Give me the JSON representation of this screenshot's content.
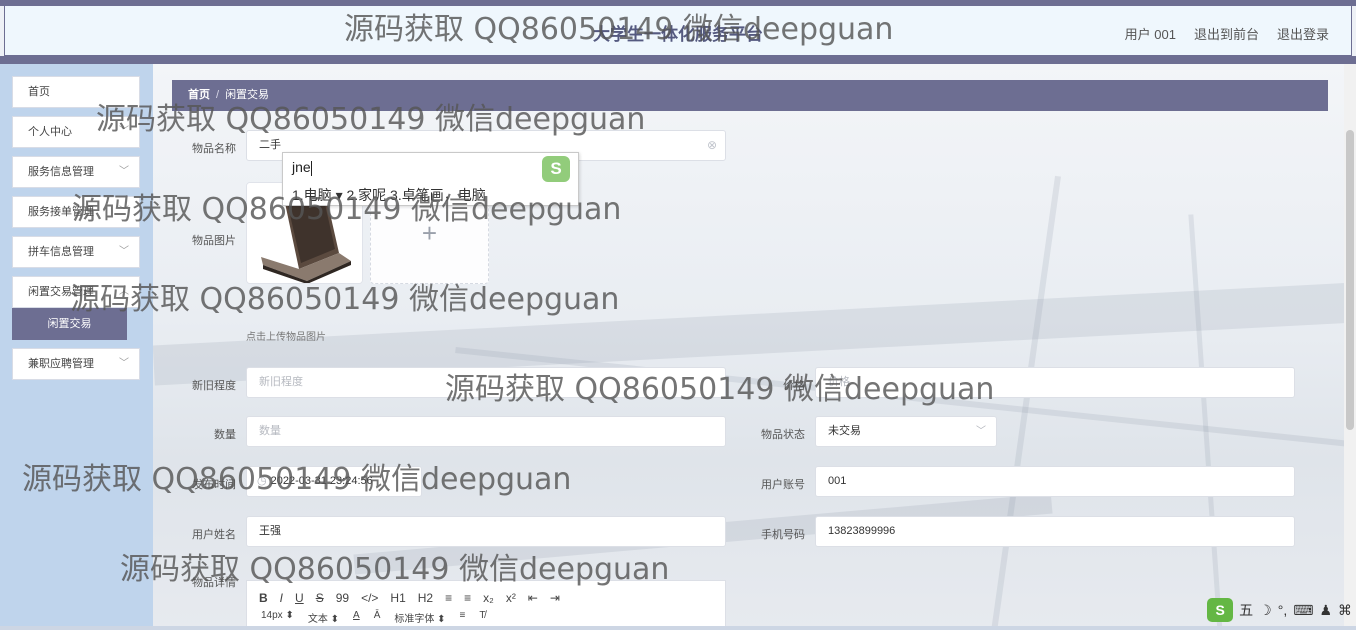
{
  "header": {
    "title": "大学生一体化服务平台",
    "links": [
      "用户 001",
      "退出到前台",
      "退出登录"
    ]
  },
  "sidebar": {
    "items": [
      {
        "label": "首页",
        "has_chevron": false
      },
      {
        "label": "个人中心",
        "has_chevron": true
      },
      {
        "label": "服务信息管理",
        "has_chevron": true
      },
      {
        "label": "服务接单管理",
        "has_chevron": true
      },
      {
        "label": "拼车信息管理",
        "has_chevron": true
      },
      {
        "label": "闲置交易管理",
        "has_chevron": true
      },
      {
        "label": "兼职应聘管理",
        "has_chevron": true
      }
    ],
    "active_sub": "闲置交易"
  },
  "breadcrumb": {
    "home": "首页",
    "sep": "/",
    "current": "闲置交易"
  },
  "form": {
    "item_name": {
      "label": "物品名称",
      "value": "二手"
    },
    "item_image": {
      "label": "物品图片",
      "hint": "点击上传物品图片",
      "add_symbol": "+"
    },
    "condition": {
      "label": "新旧程度",
      "placeholder": "新旧程度"
    },
    "price": {
      "label": "价格",
      "placeholder": "价格"
    },
    "quantity": {
      "label": "数量",
      "placeholder": "数量"
    },
    "status": {
      "label": "物品状态",
      "value": "未交易"
    },
    "publish_time": {
      "label": "发布时间",
      "value": "2022-03-31 23:24:56"
    },
    "user_account": {
      "label": "用户账号",
      "value": "001"
    },
    "user_name": {
      "label": "用户姓名",
      "value": "王强"
    },
    "phone": {
      "label": "手机号码",
      "value": "13823899996"
    },
    "detail": {
      "label": "物品详情"
    }
  },
  "editor": {
    "row1": [
      "B",
      "I",
      "U",
      "S",
      "99",
      "</>",
      "H1",
      "H2",
      "≡",
      "≡",
      "x₂",
      "x²",
      "⇤",
      "⇥"
    ],
    "font_size": "14px",
    "text_type": "文本",
    "font_family": "标准字体"
  },
  "ime": {
    "input": "jne",
    "candidates": "1.电脑 ▾  2.家呢  3.卓笔画，电脑"
  },
  "watermark": "源码获取 QQ86050149 微信deepguan",
  "ime_bar": {
    "mode": "五"
  }
}
